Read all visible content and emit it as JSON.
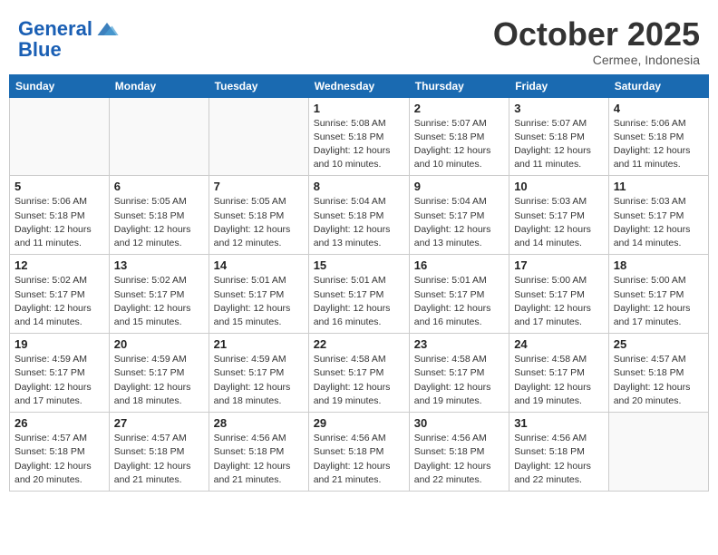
{
  "header": {
    "logo_line1": "General",
    "logo_line2": "Blue",
    "month": "October 2025",
    "location": "Cermee, Indonesia"
  },
  "weekdays": [
    "Sunday",
    "Monday",
    "Tuesday",
    "Wednesday",
    "Thursday",
    "Friday",
    "Saturday"
  ],
  "weeks": [
    [
      {
        "day": "",
        "info": ""
      },
      {
        "day": "",
        "info": ""
      },
      {
        "day": "",
        "info": ""
      },
      {
        "day": "1",
        "info": "Sunrise: 5:08 AM\nSunset: 5:18 PM\nDaylight: 12 hours\nand 10 minutes."
      },
      {
        "day": "2",
        "info": "Sunrise: 5:07 AM\nSunset: 5:18 PM\nDaylight: 12 hours\nand 10 minutes."
      },
      {
        "day": "3",
        "info": "Sunrise: 5:07 AM\nSunset: 5:18 PM\nDaylight: 12 hours\nand 11 minutes."
      },
      {
        "day": "4",
        "info": "Sunrise: 5:06 AM\nSunset: 5:18 PM\nDaylight: 12 hours\nand 11 minutes."
      }
    ],
    [
      {
        "day": "5",
        "info": "Sunrise: 5:06 AM\nSunset: 5:18 PM\nDaylight: 12 hours\nand 11 minutes."
      },
      {
        "day": "6",
        "info": "Sunrise: 5:05 AM\nSunset: 5:18 PM\nDaylight: 12 hours\nand 12 minutes."
      },
      {
        "day": "7",
        "info": "Sunrise: 5:05 AM\nSunset: 5:18 PM\nDaylight: 12 hours\nand 12 minutes."
      },
      {
        "day": "8",
        "info": "Sunrise: 5:04 AM\nSunset: 5:18 PM\nDaylight: 12 hours\nand 13 minutes."
      },
      {
        "day": "9",
        "info": "Sunrise: 5:04 AM\nSunset: 5:17 PM\nDaylight: 12 hours\nand 13 minutes."
      },
      {
        "day": "10",
        "info": "Sunrise: 5:03 AM\nSunset: 5:17 PM\nDaylight: 12 hours\nand 14 minutes."
      },
      {
        "day": "11",
        "info": "Sunrise: 5:03 AM\nSunset: 5:17 PM\nDaylight: 12 hours\nand 14 minutes."
      }
    ],
    [
      {
        "day": "12",
        "info": "Sunrise: 5:02 AM\nSunset: 5:17 PM\nDaylight: 12 hours\nand 14 minutes."
      },
      {
        "day": "13",
        "info": "Sunrise: 5:02 AM\nSunset: 5:17 PM\nDaylight: 12 hours\nand 15 minutes."
      },
      {
        "day": "14",
        "info": "Sunrise: 5:01 AM\nSunset: 5:17 PM\nDaylight: 12 hours\nand 15 minutes."
      },
      {
        "day": "15",
        "info": "Sunrise: 5:01 AM\nSunset: 5:17 PM\nDaylight: 12 hours\nand 16 minutes."
      },
      {
        "day": "16",
        "info": "Sunrise: 5:01 AM\nSunset: 5:17 PM\nDaylight: 12 hours\nand 16 minutes."
      },
      {
        "day": "17",
        "info": "Sunrise: 5:00 AM\nSunset: 5:17 PM\nDaylight: 12 hours\nand 17 minutes."
      },
      {
        "day": "18",
        "info": "Sunrise: 5:00 AM\nSunset: 5:17 PM\nDaylight: 12 hours\nand 17 minutes."
      }
    ],
    [
      {
        "day": "19",
        "info": "Sunrise: 4:59 AM\nSunset: 5:17 PM\nDaylight: 12 hours\nand 17 minutes."
      },
      {
        "day": "20",
        "info": "Sunrise: 4:59 AM\nSunset: 5:17 PM\nDaylight: 12 hours\nand 18 minutes."
      },
      {
        "day": "21",
        "info": "Sunrise: 4:59 AM\nSunset: 5:17 PM\nDaylight: 12 hours\nand 18 minutes."
      },
      {
        "day": "22",
        "info": "Sunrise: 4:58 AM\nSunset: 5:17 PM\nDaylight: 12 hours\nand 19 minutes."
      },
      {
        "day": "23",
        "info": "Sunrise: 4:58 AM\nSunset: 5:17 PM\nDaylight: 12 hours\nand 19 minutes."
      },
      {
        "day": "24",
        "info": "Sunrise: 4:58 AM\nSunset: 5:17 PM\nDaylight: 12 hours\nand 19 minutes."
      },
      {
        "day": "25",
        "info": "Sunrise: 4:57 AM\nSunset: 5:18 PM\nDaylight: 12 hours\nand 20 minutes."
      }
    ],
    [
      {
        "day": "26",
        "info": "Sunrise: 4:57 AM\nSunset: 5:18 PM\nDaylight: 12 hours\nand 20 minutes."
      },
      {
        "day": "27",
        "info": "Sunrise: 4:57 AM\nSunset: 5:18 PM\nDaylight: 12 hours\nand 21 minutes."
      },
      {
        "day": "28",
        "info": "Sunrise: 4:56 AM\nSunset: 5:18 PM\nDaylight: 12 hours\nand 21 minutes."
      },
      {
        "day": "29",
        "info": "Sunrise: 4:56 AM\nSunset: 5:18 PM\nDaylight: 12 hours\nand 21 minutes."
      },
      {
        "day": "30",
        "info": "Sunrise: 4:56 AM\nSunset: 5:18 PM\nDaylight: 12 hours\nand 22 minutes."
      },
      {
        "day": "31",
        "info": "Sunrise: 4:56 AM\nSunset: 5:18 PM\nDaylight: 12 hours\nand 22 minutes."
      },
      {
        "day": "",
        "info": ""
      }
    ]
  ]
}
